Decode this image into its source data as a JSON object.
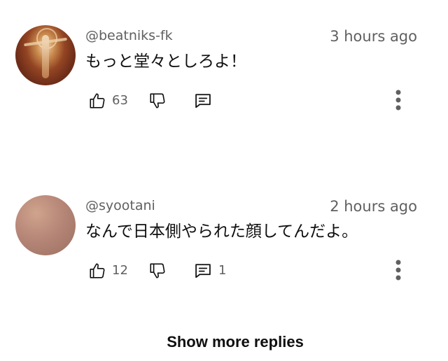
{
  "comments": [
    {
      "username": "@beatniks-fk",
      "timestamp": "3 hours ago",
      "text": "もっと堂々としろよ！",
      "likes": "63",
      "replies": ""
    },
    {
      "username": "@syootani",
      "timestamp": "2 hours ago",
      "text": "なんで日本側やられた顔してんだよ。",
      "likes": "12",
      "replies": "1"
    }
  ],
  "show_more_label": "Show more replies",
  "icons": {
    "like": "thumbs-up-icon",
    "dislike": "thumbs-down-icon",
    "reply": "comment-icon",
    "more": "more-vertical-icon"
  }
}
